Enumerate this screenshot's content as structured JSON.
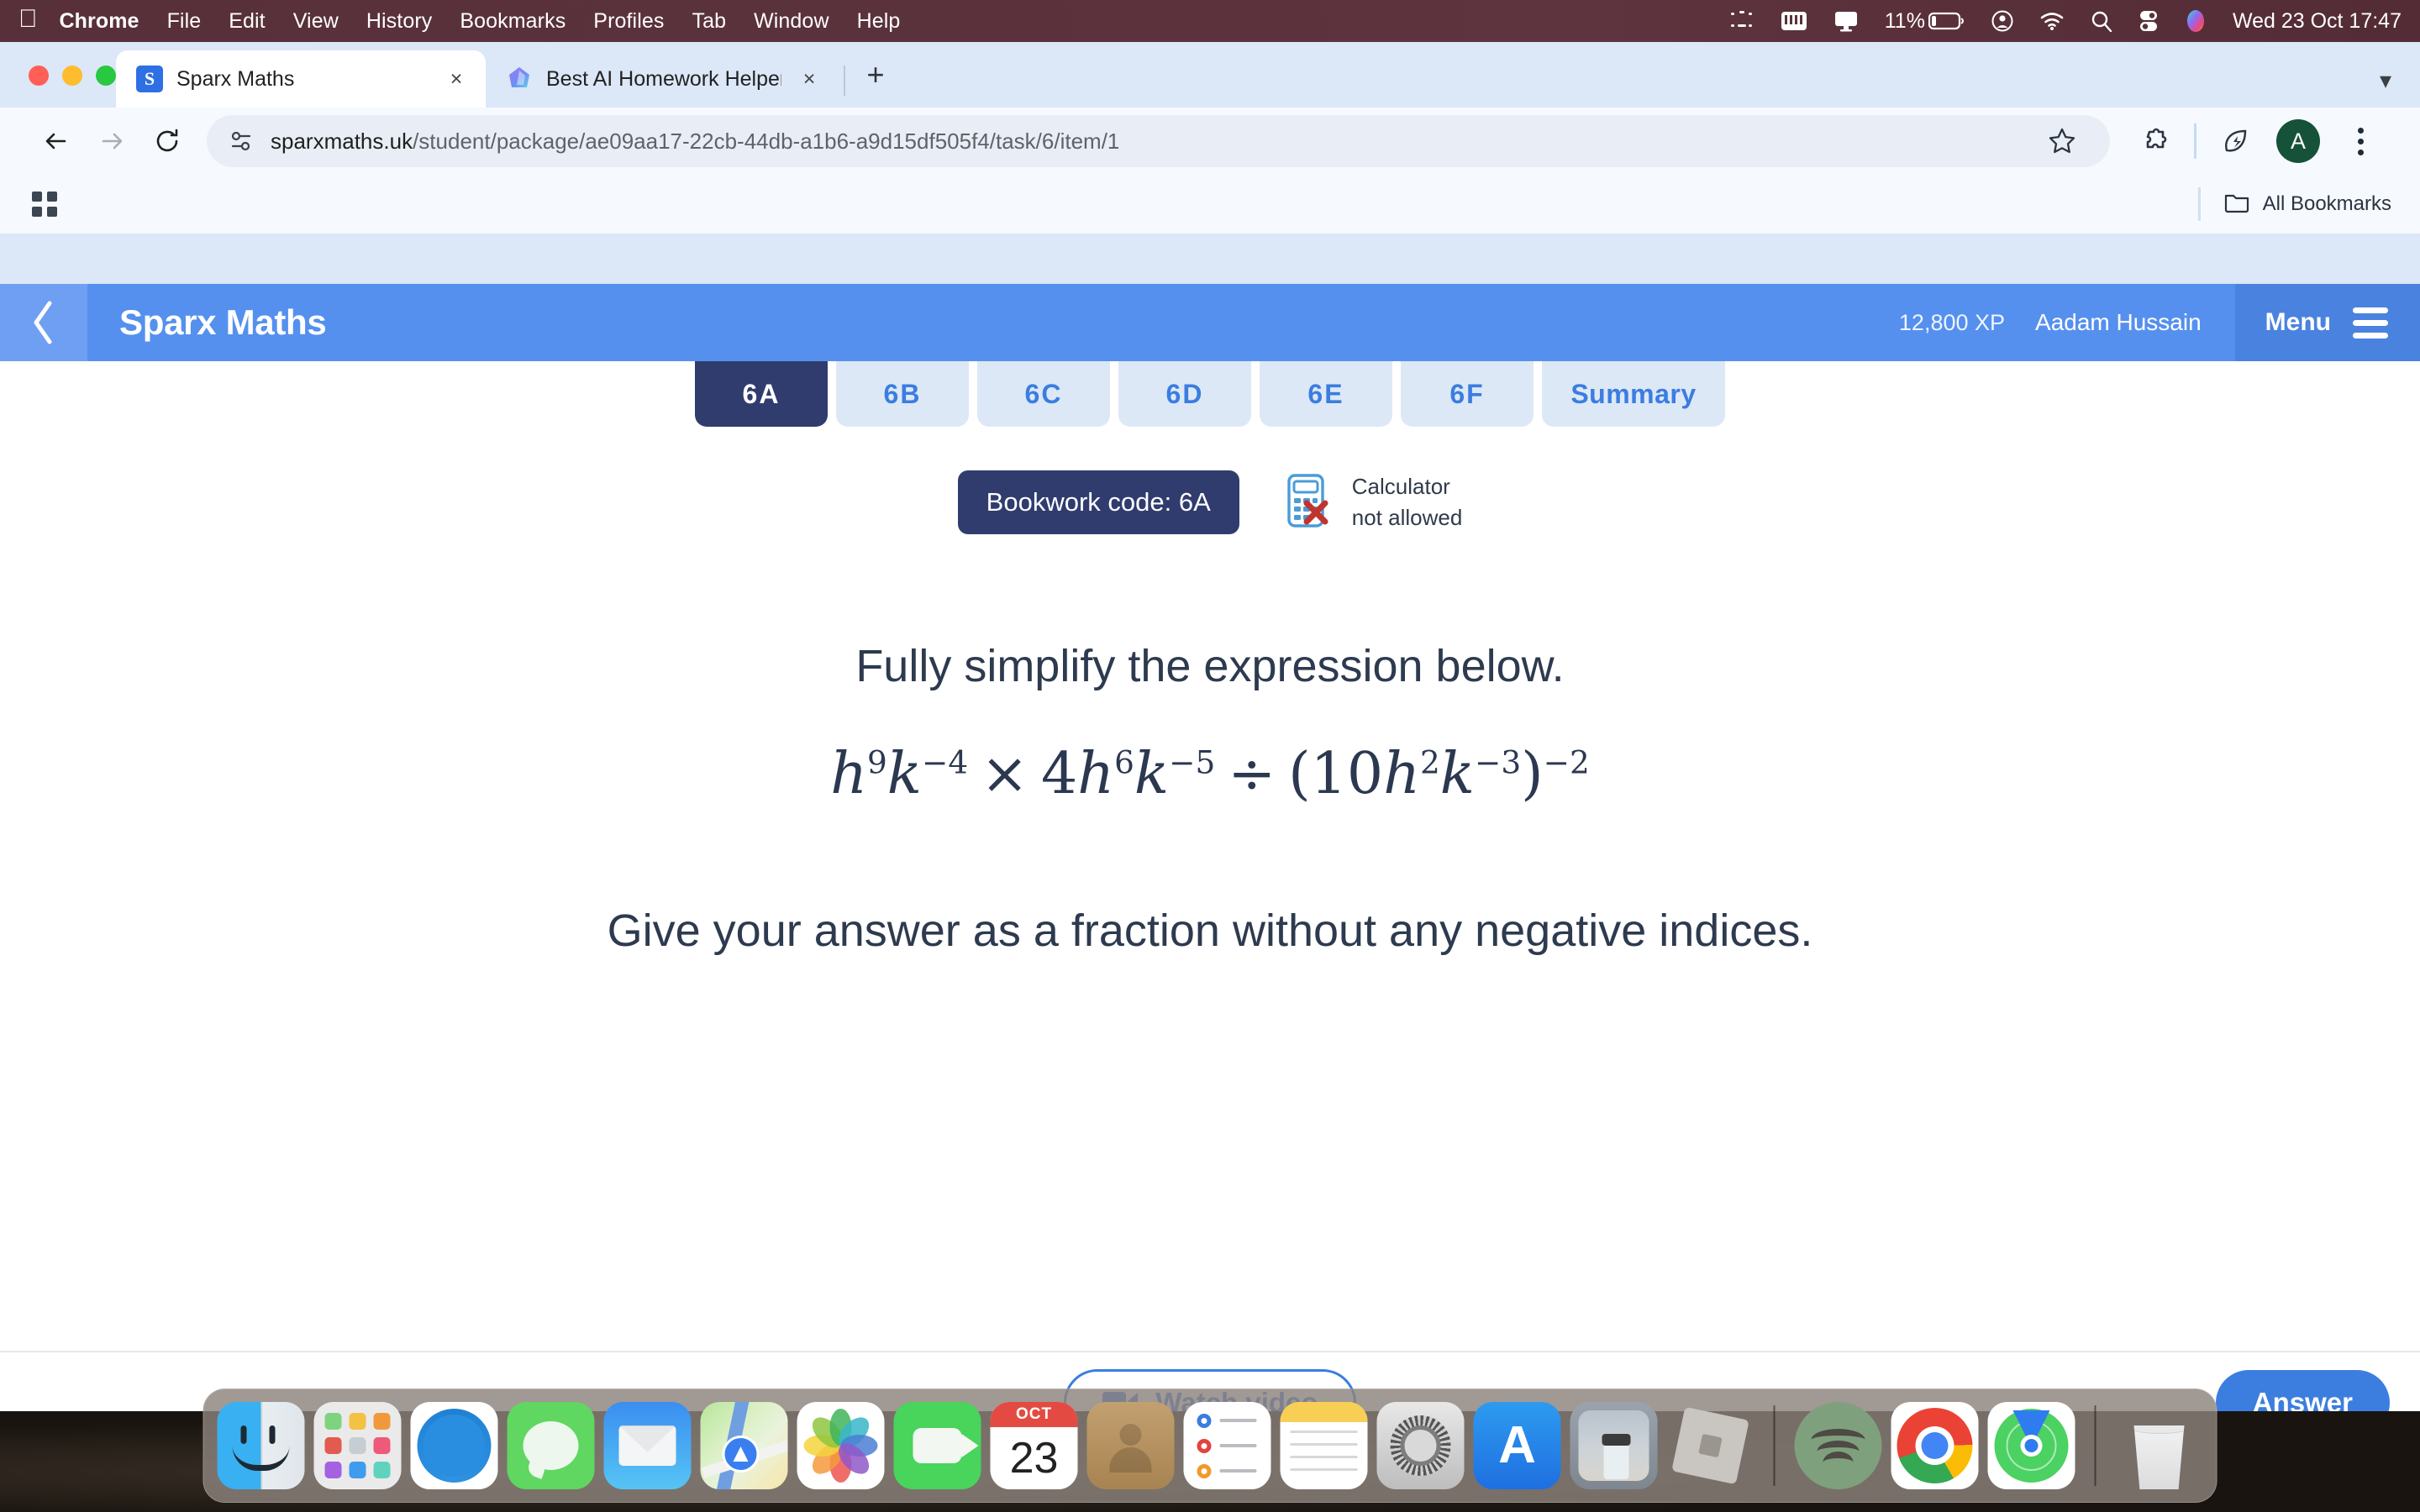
{
  "menubar": {
    "apple_icon": "apple-logo-icon",
    "items": [
      {
        "label": "Chrome",
        "bold": true
      },
      {
        "label": "File",
        "bold": false
      },
      {
        "label": "Edit",
        "bold": false
      },
      {
        "label": "View",
        "bold": false
      },
      {
        "label": "History",
        "bold": false
      },
      {
        "label": "Bookmarks",
        "bold": false
      },
      {
        "label": "Profiles",
        "bold": false
      },
      {
        "label": "Tab",
        "bold": false
      },
      {
        "label": "Window",
        "bold": false
      },
      {
        "label": "Help",
        "bold": false
      }
    ],
    "status_icons": [
      "dotted-rect-icon",
      "keyboard-icon",
      "display-icon",
      "battery-icon",
      "control-center-user-icon",
      "wifi-icon",
      "spotlight-search-icon",
      "control-center-icon",
      "siri-icon"
    ],
    "battery_percent": "11%",
    "clock": "Wed 23 Oct  17:47"
  },
  "browser": {
    "tabs": [
      {
        "title": "Sparx Maths",
        "favicon": "sparx-favicon",
        "active": true,
        "close_label": "×"
      },
      {
        "title": "Best AI Homework Helper & H",
        "favicon": "ai-helper-favicon",
        "active": false,
        "close_label": "×"
      }
    ],
    "new_tab_label": "+",
    "tab_list_chevron": "chevron-down-icon",
    "toolbar": {
      "back_icon": "back-arrow-icon",
      "forward_icon": "forward-arrow-icon",
      "reload_icon": "reload-icon",
      "site_info_icon": "site-settings-icon",
      "url": "sparxmaths.uk/student/package/ae09aa17-22cb-44db-a1b6-a9d15df505f4/task/6/item/1",
      "url_domain": "sparxmaths.uk",
      "url_path": "/student/package/ae09aa17-22cb-44db-a1b6-a9d15df505f4/task/6/item/1",
      "bookmark_icon": "star-icon",
      "extensions_icon": "puzzle-piece-icon",
      "performance_icon": "energy-saver-leaf-icon",
      "profile_initial": "A",
      "menu_icon": "three-dot-menu-icon"
    },
    "bookmarks_bar": {
      "apps_icon": "apps-grid-icon",
      "all_bookmarks_label": "All Bookmarks",
      "folder_icon": "folder-icon"
    }
  },
  "sparx": {
    "back_icon": "chevron-left-icon",
    "logo": "Sparx Maths",
    "xp": "12,800 XP",
    "user": "Aadam Hussain",
    "menu_label": "Menu",
    "menu_icon": "hamburger-icon",
    "subtabs": [
      {
        "label": "6A",
        "active": true
      },
      {
        "label": "6B",
        "active": false
      },
      {
        "label": "6C",
        "active": false
      },
      {
        "label": "6D",
        "active": false
      },
      {
        "label": "6E",
        "active": false
      },
      {
        "label": "6F",
        "active": false
      },
      {
        "label": "Summary",
        "active": false
      }
    ],
    "bookwork_code": "Bookwork code: 6A",
    "calculator": {
      "icon": "calculator-not-allowed-icon",
      "line1": "Calculator",
      "line2": "not allowed"
    },
    "question": {
      "prompt": "Fully simplify the expression below.",
      "expression_plain": "h^9 k^-4 × 4h^6 k^-5 ÷ (10h^2 k^-3)^-2",
      "expression_parts": {
        "t1_base": "h",
        "t1_exp": "9",
        "t2_base": "k",
        "t2_exp": "−4",
        "op1": "×",
        "t3_coef": "4",
        "t3_base": "h",
        "t3_exp": "6",
        "t4_base": "k",
        "t4_exp": "−5",
        "op2": "÷",
        "open_paren": "(",
        "t5_coef": "10",
        "t5_base": "h",
        "t5_exp": "2",
        "t6_base": "k",
        "t6_exp": "−3",
        "close_paren": ")",
        "outer_exp": "−2"
      },
      "instruction": "Give your answer as a fraction without any negative indices."
    },
    "footer": {
      "watch_video_label": "Watch video",
      "video_icon": "video-camera-icon",
      "answer_label": "Answer"
    }
  },
  "dock": {
    "items": [
      {
        "name": "finder",
        "label": "Finder",
        "running": true
      },
      {
        "name": "launchpad",
        "label": "Launchpad",
        "running": false
      },
      {
        "name": "safari",
        "label": "Safari",
        "running": false
      },
      {
        "name": "messages",
        "label": "Messages",
        "running": false
      },
      {
        "name": "mail",
        "label": "Mail",
        "running": false
      },
      {
        "name": "maps",
        "label": "Maps",
        "running": false
      },
      {
        "name": "photos",
        "label": "Photos",
        "running": false
      },
      {
        "name": "facetime",
        "label": "FaceTime",
        "running": false
      },
      {
        "name": "calendar",
        "label": "Calendar",
        "running": false
      },
      {
        "name": "contacts",
        "label": "Contacts",
        "running": false
      },
      {
        "name": "reminders",
        "label": "Reminders",
        "running": false
      },
      {
        "name": "notes",
        "label": "Notes",
        "running": false
      },
      {
        "name": "settings",
        "label": "System Settings",
        "running": false
      },
      {
        "name": "appstore",
        "label": "App Store",
        "running": false
      },
      {
        "name": "freeform",
        "label": "Freeform",
        "running": false
      },
      {
        "name": "roblox",
        "label": "Roblox",
        "running": false
      },
      {
        "name": "spotify",
        "label": "Spotify",
        "running": true
      },
      {
        "name": "chrome",
        "label": "Google Chrome",
        "running": true
      },
      {
        "name": "findmy",
        "label": "Find My",
        "running": false
      },
      {
        "name": "trash",
        "label": "Trash",
        "running": false
      }
    ],
    "calendar_month": "OCT",
    "calendar_day": "23",
    "appstore_glyph": "A"
  }
}
